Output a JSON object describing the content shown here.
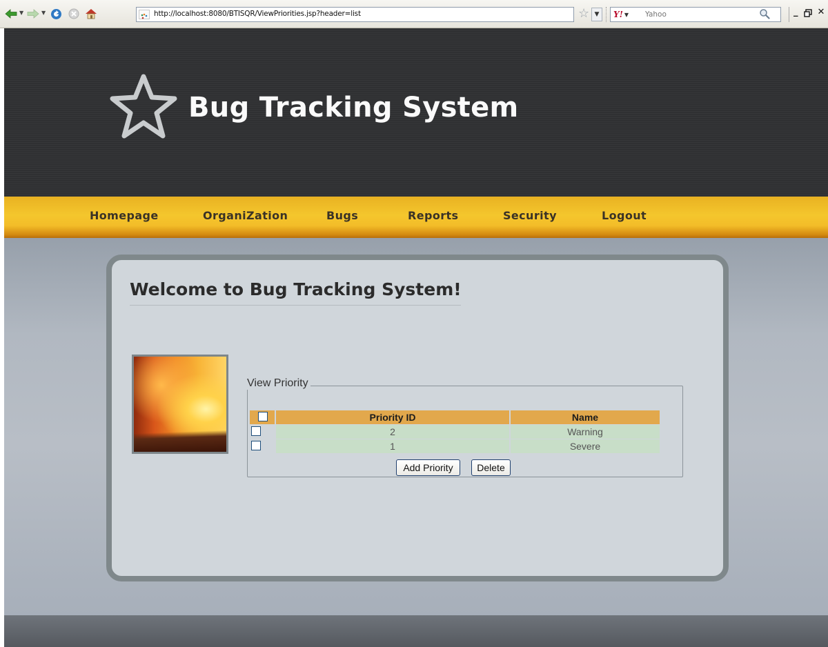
{
  "browser": {
    "url": "http://localhost:8080/BTISQR/ViewPriorities.jsp?header=list",
    "search_placeholder": "Yahoo",
    "search_engine_logo": "Y!",
    "window_controls": [
      "_",
      "ɑ",
      "×"
    ],
    "icons": [
      "back-arrow-icon",
      "forward-arrow-icon",
      "reload-icon",
      "stop-icon",
      "home-icon",
      "bookmark-star-icon",
      "search-magnifier-icon"
    ]
  },
  "header": {
    "title": "Bug Tracking System",
    "logo_icon": "star-outline-icon"
  },
  "nav": {
    "items": [
      {
        "label": "Homepage"
      },
      {
        "label": "OrganiZation"
      },
      {
        "label": "Bugs"
      },
      {
        "label": "Reports"
      },
      {
        "label": "Security"
      },
      {
        "label": "Logout"
      }
    ]
  },
  "main": {
    "welcome": "Welcome to Bug Tracking System!",
    "panel": {
      "legend": "View Priority",
      "columns": [
        "Priority ID",
        "Name"
      ],
      "rows": [
        {
          "id": "2",
          "name": "Warning"
        },
        {
          "id": "1",
          "name": "Severe"
        }
      ],
      "buttons": {
        "add": "Add Priority",
        "delete": "Delete"
      }
    }
  },
  "colors": {
    "header_bg": "#2f3032",
    "nav_gold": "#f4c62d",
    "table_head": "#e2a84c",
    "table_row": "#c8dec8",
    "panel_bg": "#d0d6db"
  }
}
